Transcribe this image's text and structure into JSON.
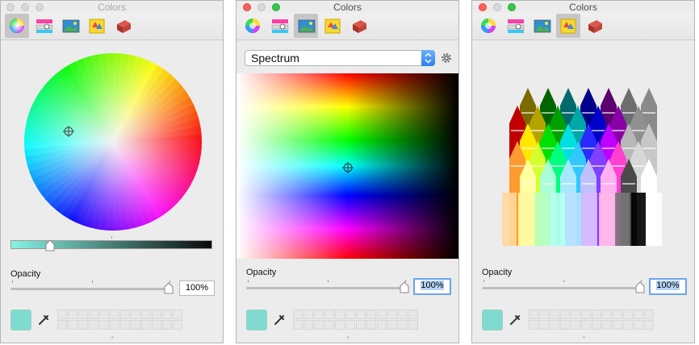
{
  "windows": [
    {
      "title": "Colors",
      "active": false,
      "pane": "color-wheel",
      "opacity_label": "Opacity",
      "opacity_value": "100%",
      "opacity_level": 1.0,
      "brightness_level": 0.18
    },
    {
      "title": "Colors",
      "active": true,
      "pane": "image-palettes",
      "popup_value": "Spectrum",
      "opacity_label": "Opacity",
      "opacity_value": "100%",
      "opacity_level": 1.0
    },
    {
      "title": "Colors",
      "active": true,
      "pane": "pencils",
      "opacity_label": "Opacity",
      "opacity_value": "100%",
      "opacity_level": 1.0
    }
  ],
  "toolbar_icons": [
    "color-wheel-icon",
    "color-sliders-icon",
    "color-palettes-icon",
    "image-palettes-icon",
    "pencils-icon"
  ],
  "current_color": "#7fdbd0",
  "icons": {
    "eyedropper": "eyedropper-icon",
    "gear": "gear-icon",
    "crosshair": "crosshair-icon"
  }
}
